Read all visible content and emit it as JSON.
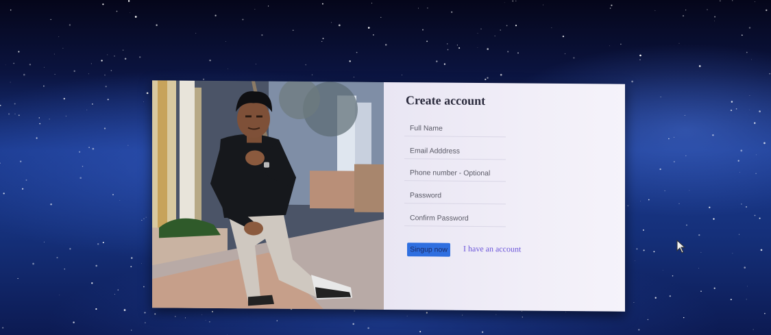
{
  "signup_form": {
    "title": "Create account",
    "fields": {
      "full_name": "Full Name",
      "email": "Email Adddress",
      "phone": "Phone number - Optional",
      "password": "Password",
      "confirm_password": "Confirm Password"
    },
    "signup_button": "Singup now",
    "login_link": "I have an account"
  },
  "colors": {
    "button": "#2f6fe0",
    "link": "#6b55d9",
    "panel": "#efecf6"
  },
  "icons": {
    "cursor": "mouse-pointer-icon"
  }
}
